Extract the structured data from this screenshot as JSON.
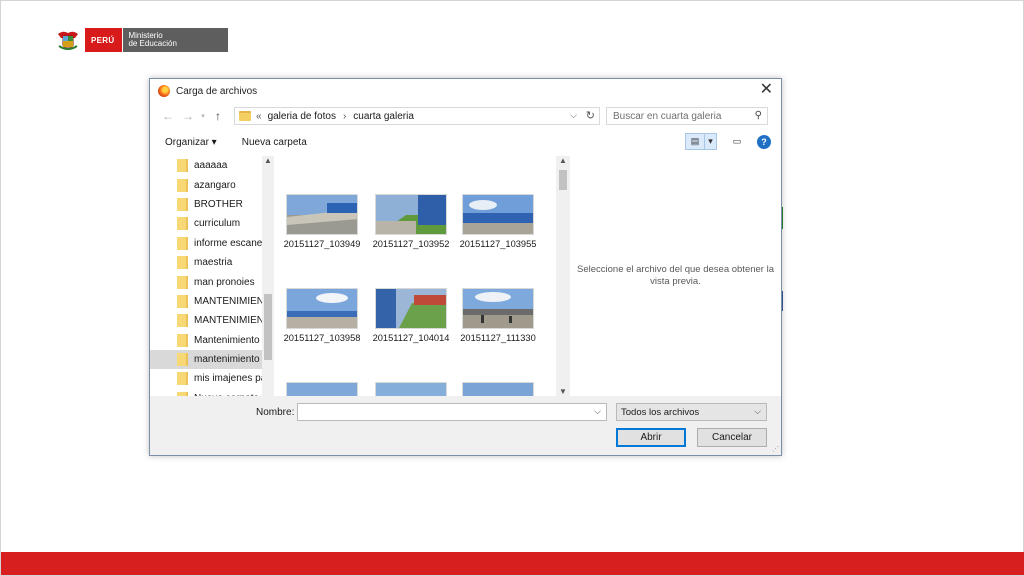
{
  "logo": {
    "country": "PERÚ",
    "ministry_line1": "Ministerio",
    "ministry_line2": "de Educación"
  },
  "dialog": {
    "title": "Carga de archivos",
    "close_glyph": "✕",
    "address": {
      "prefix": "«",
      "crumb1": "galeria de fotos",
      "separator": "›",
      "crumb2": "cuarta galeria"
    },
    "search_placeholder": "Buscar en cuarta galeria",
    "toolbar": {
      "organize": "Organizar ▾",
      "new_folder": "Nueva carpeta"
    },
    "nav_items": [
      "aaaaaa",
      "azangaro",
      "BROTHER",
      "curriculum",
      "informe escanea",
      "maestria",
      "man pronoies",
      "MANTENIMIENT",
      "MANTENIMIENT",
      "Mantenimiento",
      "mantenimiento",
      "mis imajenes pa",
      "Nueva carpeta"
    ],
    "selected_nav_index": 10,
    "files": [
      "20151127_103949",
      "20151127_103952",
      "20151127_103955",
      "20151127_103958",
      "20151127_104014",
      "20151127_111330",
      "",
      "",
      ""
    ],
    "preview_text": "Seleccione el archivo del que desea obtener la vista previa.",
    "name_label": "Nombre:",
    "name_value": "",
    "filter_value": "Todos los archivos",
    "open_button": "Abrir",
    "cancel_button": "Cancelar"
  },
  "colors": {
    "brand_red": "#d91a1a",
    "footer_red": "#d71f1f",
    "dialog_border": "#7a8ea8",
    "accent_blue": "#0078d7"
  }
}
